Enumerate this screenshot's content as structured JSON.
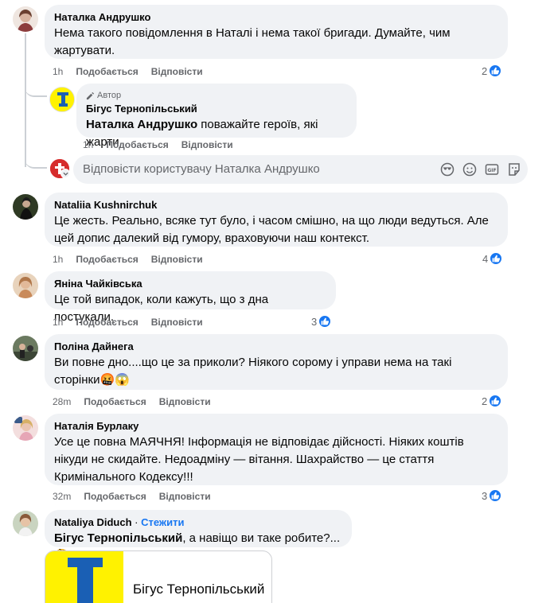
{
  "comments": [
    {
      "author": "Наталка Андрушко",
      "text": "Нема такого повідомлення в Наталі і нема такої бригади. Думайте, чим жартувати.",
      "time": "1h",
      "like": "Подобається",
      "reply": "Відповісти",
      "reactions": "2",
      "avatar_color": "#c9a99a"
    },
    {
      "badge": "Автор",
      "author": "Бігус Тернопільський",
      "mention": "Наталка Андрушко",
      "text": " поважайте героїв, які жарти",
      "time": "1h",
      "like": "Подобається",
      "reply": "Відповісти"
    },
    {
      "author": "Nataliia Kushnirchuk",
      "text": "Це жесть. Реально, всяке тут було, і часом смішно, на що люди ведуться. Але цей допис далекий від гумору, враховуючи наш контекст.",
      "time": "1h",
      "like": "Подобається",
      "reply": "Відповісти",
      "reactions": "4",
      "avatar_color": "#3d4a2c"
    },
    {
      "author": "Яніна Чайківська",
      "text": "Це той випадок, коли кажуть, що з дна постукали.",
      "time": "1h",
      "like": "Подобається",
      "reply": "Відповісти",
      "reactions": "3",
      "avatar_color": "#d9b48f"
    },
    {
      "author": "Поліна Дайнега",
      "text": "Ви повне дно....що це за приколи? Ніякого сорому і управи нема на такі сторінки🤬😱",
      "time": "28m",
      "like": "Подобається",
      "reply": "Відповісти",
      "reactions": "2",
      "avatar_color": "#4e5a45"
    },
    {
      "author": "Наталія Бурлаку",
      "text": "Усе це повна МАЯЧНЯ! Інформація не відповідає дійсності. Ніяких коштів нікуди не скидайте. Недоадміну — вітання. Шахрайство — це стаття Кримінального Кодексу!!!",
      "time": "32m",
      "like": "Подобається",
      "reply": "Відповісти",
      "reactions": "3",
      "avatar_color": "#e7b9b0"
    },
    {
      "author": "Nataliya Diduch",
      "follow": "Стежити",
      "mention": "Бігус Тернопільський",
      "text": ", а навіщо ви таке робите?... 🤔",
      "avatar_color": "#a8b8a0"
    }
  ],
  "reply_box": {
    "placeholder": "Відповісти користувачу Наталка Андрушко"
  },
  "link_card": {
    "title": "Бігус Тернопільський"
  },
  "colors": {
    "accent": "#1877f2",
    "bubble": "#f0f2f5",
    "muted": "#65676b",
    "logo_yellow": "#fff200",
    "logo_blue": "#1a5fb4"
  }
}
